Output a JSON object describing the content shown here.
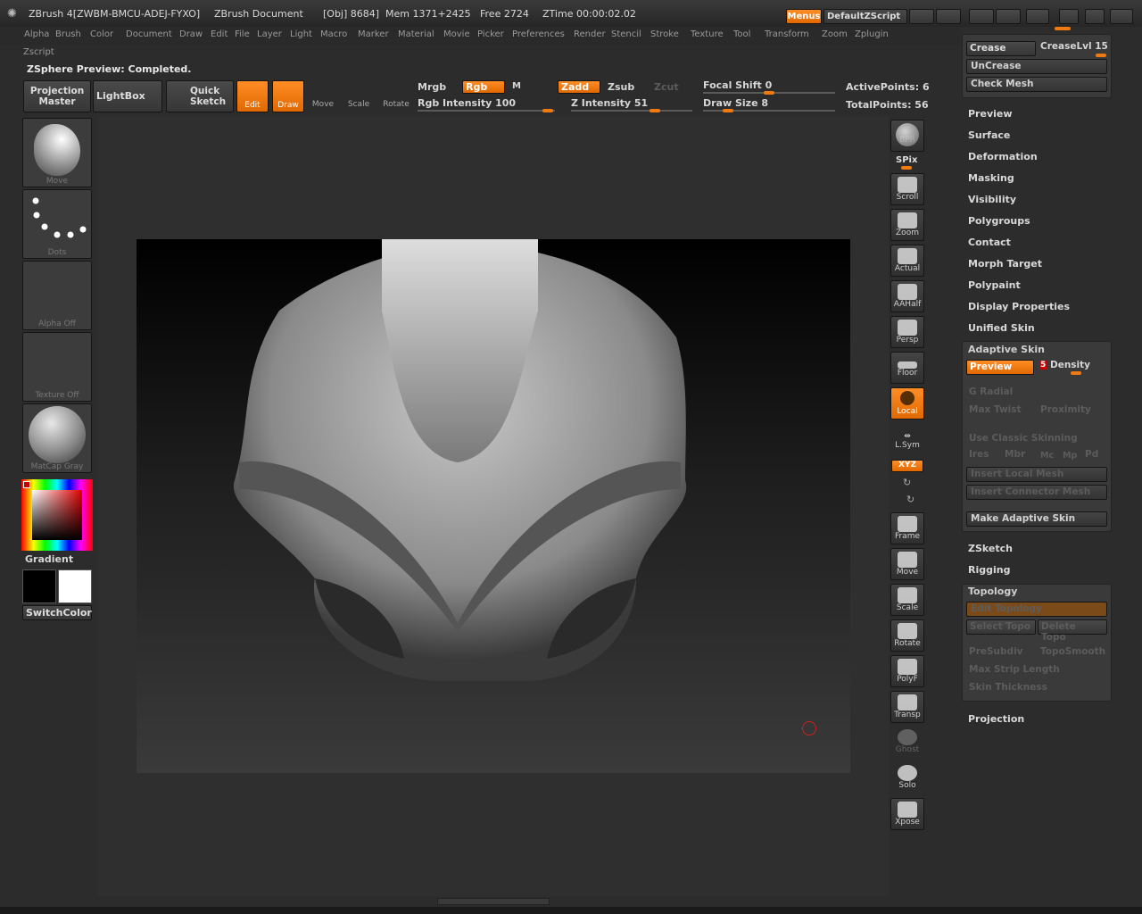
{
  "title_bar": {
    "app_title": "ZBrush 4[ZWBM-BMCU-ADEJ-FYXO]",
    "document": "ZBrush Document",
    "obj": "[Obj] 8684]",
    "mem": "Mem 1371+2425",
    "free": "Free 2724",
    "ztime": "ZTime 00:00:02.02",
    "menus_label": "Menus",
    "script_label": "DefaultZScript"
  },
  "menu": {
    "items": [
      "Alpha",
      "Brush",
      "Color",
      "Document",
      "Draw",
      "Edit",
      "File",
      "Layer",
      "Light",
      "Macro",
      "Marker",
      "Material",
      "Movie",
      "Picker",
      "Preferences",
      "Render",
      "Stencil",
      "Stroke",
      "Texture",
      "Tool",
      "Transform",
      "Zoom",
      "Zplugin"
    ],
    "zscript": "Zscript"
  },
  "status": "ZSphere Preview: Completed.",
  "toolbar": {
    "projection_master": "Projection Master",
    "lightbox": "LightBox",
    "quick_sketch": "Quick Sketch",
    "edit": "Edit",
    "draw": "Draw",
    "move": "Move",
    "scale": "Scale",
    "rotate": "Rotate",
    "mrgb": "Mrgb",
    "rgb": "Rgb",
    "m": "M",
    "zadd": "Zadd",
    "zsub": "Zsub",
    "zcut": "Zcut",
    "rgb_intensity": "Rgb Intensity 100",
    "z_intensity": "Z Intensity 51",
    "focal_shift": "Focal Shift 0",
    "draw_size": "Draw Size 8",
    "active_points": "ActivePoints: 6",
    "total_points": "TotalPoints: 56"
  },
  "left_shelf": {
    "brush": "Move",
    "stroke": "Dots",
    "alpha": "Alpha Off",
    "texture": "Texture Off",
    "material": "MatCap Gray",
    "gradient": "Gradient",
    "switch_color": "SwitchColor"
  },
  "right_tools": {
    "bpr": "BPR",
    "spix": "SPix",
    "scroll": "Scroll",
    "zoom": "Zoom",
    "actual": "Actual",
    "aahalf": "AAHalf",
    "persp": "Persp",
    "floor": "Floor",
    "local": "Local",
    "lsym": "L.Sym",
    "xyz": "XYZ",
    "frame": "Frame",
    "move": "Move",
    "scale": "Scale",
    "rotate": "Rotate",
    "polyf": "PolyF",
    "transp": "Transp",
    "ghost": "Ghost",
    "solo": "Solo",
    "xpose": "Xpose"
  },
  "right_panel": {
    "crease": "Crease",
    "crease_lvl": "CreaseLvl 15",
    "uncrease": "UnCrease",
    "check_mesh": "Check Mesh",
    "sections": [
      "Preview",
      "Surface",
      "Deformation",
      "Masking",
      "Visibility",
      "Polygroups",
      "Contact",
      "Morph Target",
      "Polypaint",
      "Display Properties",
      "Unified Skin"
    ],
    "adaptive_skin": {
      "title": "Adaptive Skin",
      "preview": "Preview",
      "density_value": "5",
      "density": "Density",
      "g_radial": "G Radial",
      "max_twist": "Max Twist",
      "proximity": "Proximity",
      "use_classic": "Use Classic Skinning",
      "ires": "Ires",
      "mbr": "Mbr",
      "mc": "Mc",
      "mp": "Mp",
      "pd": "Pd",
      "insert_local": "Insert Local Mesh",
      "insert_connector": "Insert Connector Mesh",
      "make_adaptive": "Make Adaptive Skin"
    },
    "zsketch": "ZSketch",
    "rigging": "Rigging",
    "topology": {
      "title": "Topology",
      "edit_topology": "Edit Topology",
      "select_topo": "Select Topo",
      "delete_topo": "Delete Topo",
      "presubdiv": "PreSubdiv",
      "toposmooth": "TopoSmooth",
      "max_strip": "Max Strip Length",
      "skin_thickness": "Skin Thickness"
    },
    "projection": "Projection"
  },
  "colors": {
    "accent": "#f07a10",
    "bg": "#2c2c2c",
    "canvas": "#1c1c1c"
  }
}
